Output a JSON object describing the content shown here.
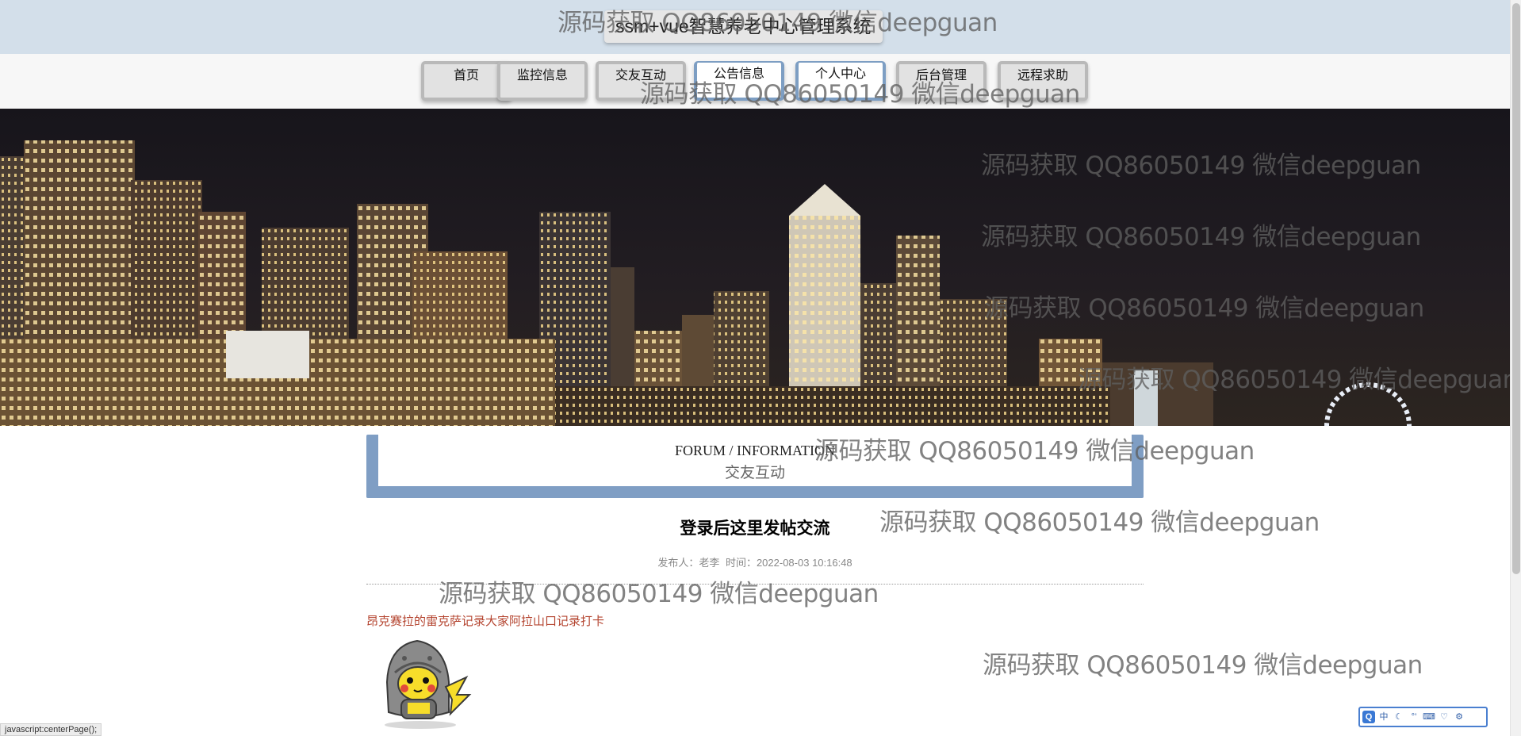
{
  "header": {
    "title": "ssm+vue智慧养老中心管理系统"
  },
  "nav": {
    "items": [
      {
        "label": "首页",
        "active": false
      },
      {
        "label": "监控信息",
        "active": false
      },
      {
        "label": "交友互动",
        "active": false
      },
      {
        "label": "公告信息",
        "active": true
      },
      {
        "label": "个人中心",
        "active": true
      },
      {
        "label": "后台管理",
        "active": false
      },
      {
        "label": "远程求助",
        "active": false
      }
    ]
  },
  "banner": {
    "dot_count": 3,
    "active_dot": 1
  },
  "section": {
    "title_en": "FORUM / INFORMATION",
    "title_cn": "交友互动"
  },
  "post": {
    "title": "登录后这里发帖交流",
    "author_label": "发布人：老李",
    "time_label": "时间：2022-08-03 10:16:48",
    "body": "昂克赛拉的雷克萨记录大家阿拉山口记录打卡"
  },
  "watermark": {
    "text": "源码获取 QQ86050149 微信deepguan"
  },
  "status_bar": {
    "text": "javascript:centerPage();"
  },
  "ime": {
    "logo": "Q",
    "mode": "中"
  },
  "colors": {
    "header_bg": "#d3dfea",
    "accent": "#7f9ec4",
    "post_body": "#b4442f"
  }
}
